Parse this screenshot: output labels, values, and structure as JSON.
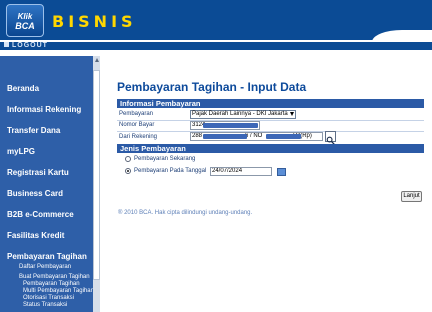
{
  "header": {
    "logo_line1": "Klik",
    "logo_line2": "BCA",
    "brand": "BISNIS",
    "logout_label": "LOGOUT"
  },
  "sidebar": {
    "items": [
      {
        "label": "Beranda"
      },
      {
        "label": "Informasi Rekening"
      },
      {
        "label": "Transfer Dana"
      },
      {
        "label": "myLPG"
      },
      {
        "label": "Registrasi Kartu"
      },
      {
        "label": "Business Card"
      },
      {
        "label": "B2B e-Commerce"
      },
      {
        "label": "Fasilitas Kredit"
      },
      {
        "label": "Pembayaran Tagihan"
      }
    ],
    "subitems": [
      {
        "label": "Daftar Pembayaran"
      },
      {
        "label": "Buat Pembayaran Tagihan"
      },
      {
        "label": "Pembayaran Tagihan"
      },
      {
        "label": "Multi Pembayaran Tagihan"
      },
      {
        "label": "Otorisasi Transaksi"
      },
      {
        "label": "Status Transaksi"
      }
    ]
  },
  "main": {
    "title": "Pembayaran Tagihan - Input Data",
    "section_info": "Informasi Pembayaran",
    "rows": {
      "pembayaran_label": "Pembayaran",
      "pembayaran_value": "Pajak Daerah Lainnya - DKI Jakarta",
      "nomor_bayar_label": "Nomor Bayar",
      "nomor_bayar_value": "3124",
      "dari_rekening_label": "Dari Rekening",
      "dari_rekening_value": "288",
      "dari_rekening_mid": "6 / NO",
      "dari_rekening_suffix": "TO(Rp)"
    },
    "section_jenis": "Jenis Pembayaran",
    "radio_now": "Pembayaran Sekarang",
    "radio_date": "Pembayaran Pada Tanggal",
    "date_value": "24/07/2024",
    "lanjut_button": "Lanjut",
    "footer": "® 2010 BCA. Hak cipta dilindungi undang-undang."
  },
  "colors": {
    "header_bg": "#0b4b95",
    "brand_yellow": "#ffd700",
    "sidebar_bg": "#2e5fa8",
    "section_bg": "#2b5aa6",
    "title_blue": "#0d4a9b"
  }
}
